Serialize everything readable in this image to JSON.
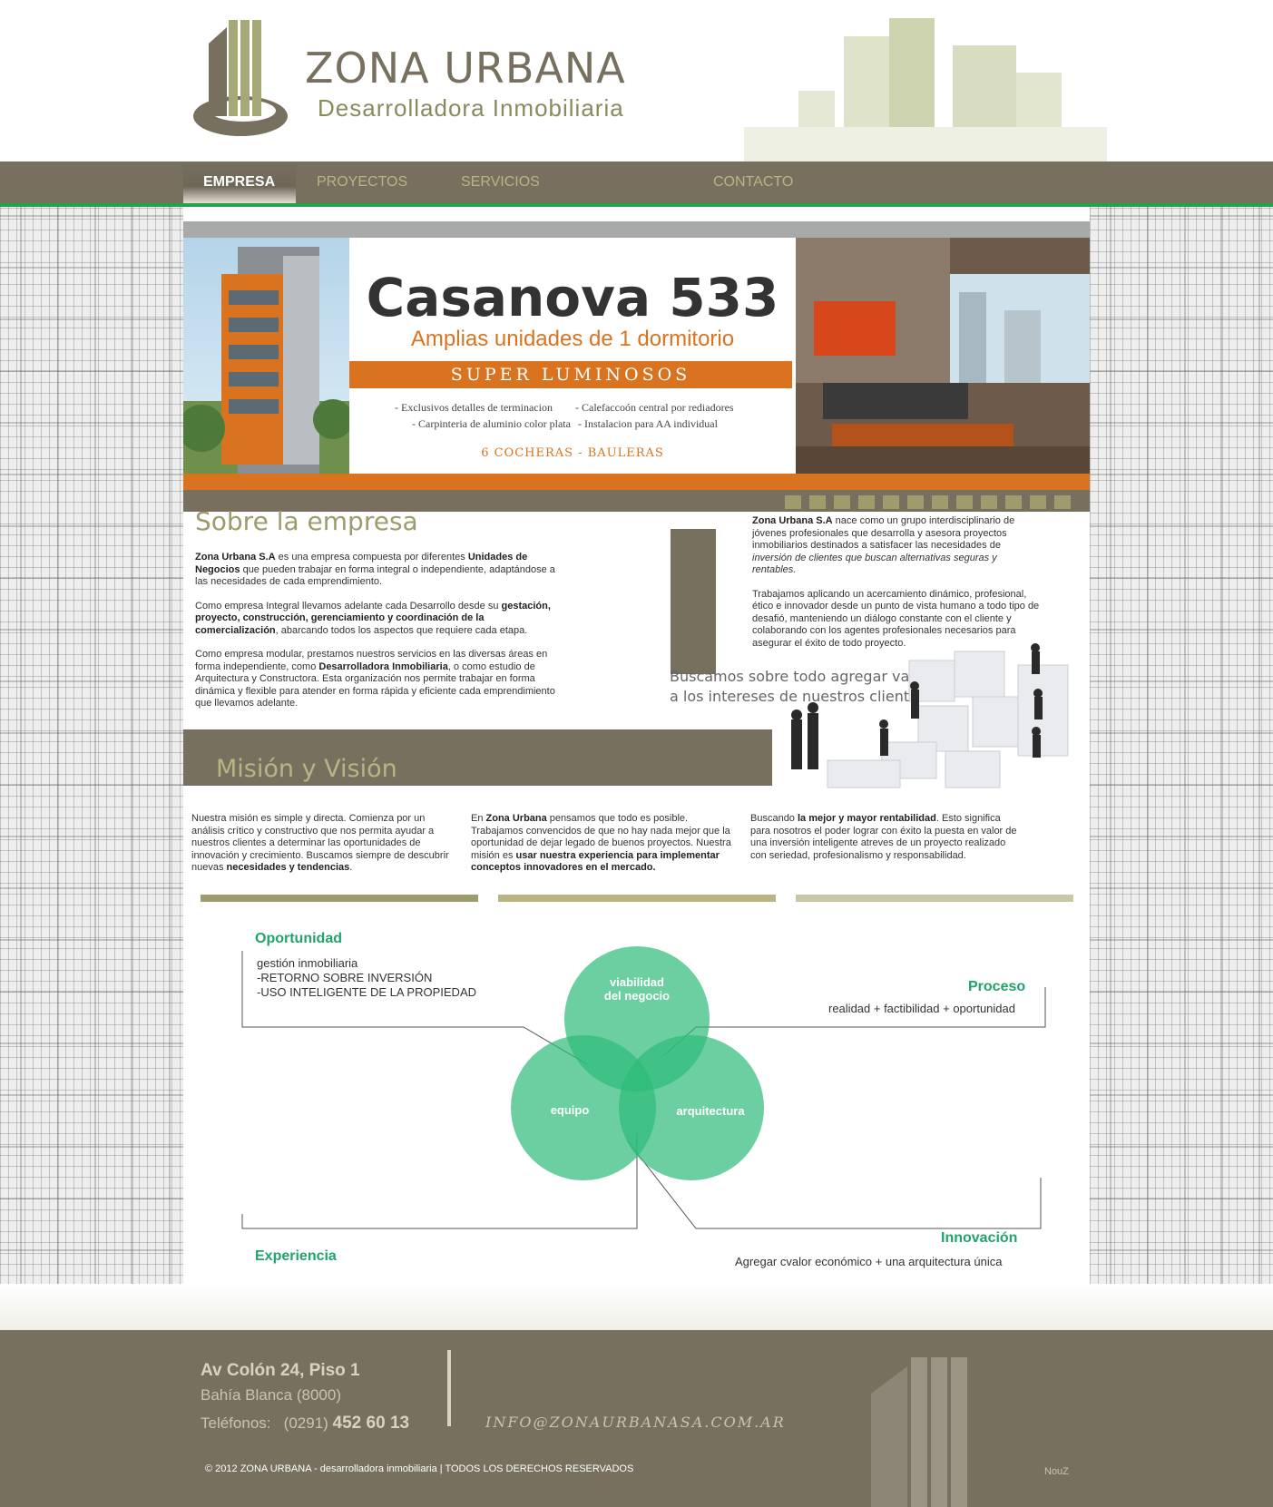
{
  "brand": {
    "name": "ZONA URBANA",
    "tagline": "Desarrolladora Inmobiliaria",
    "colors": {
      "primary": "#77705f",
      "olive": "#9e9c6c",
      "accent_green": "#23a34a",
      "orange": "#d9731f",
      "diagram_green": "#2ebb79"
    }
  },
  "nav": {
    "items": [
      {
        "label": "EMPRESA",
        "active": true
      },
      {
        "label": "PROYECTOS",
        "active": false
      },
      {
        "label": "SERVICIOS",
        "active": false
      },
      {
        "label": "CONTACTO",
        "active": false
      }
    ]
  },
  "banner": {
    "title": "Casanova 533",
    "subtitle": "Amplias unidades de 1 dormitorio",
    "strip": "SUPER LUMINOSOS",
    "features": [
      "- Exclusivos detalles de terminacion",
      "- Carpinteria de aluminio color plata",
      "- Calefaccoón central por rediadores",
      "- Instalacion para AA individual"
    ],
    "cocheras": "6 COCHERAS - BAULERAS",
    "slide_count": 12
  },
  "about": {
    "title": "Sobre la empresa",
    "slogan_line1": "Buscamos sobre todo agregar valor",
    "slogan_line2": "a los intereses de nuestros clientes."
  },
  "mision": {
    "title": "Misión y Visión"
  },
  "diagram": {
    "oportunidad": {
      "title": "Oportunidad",
      "line1": "gestión inmobiliaria",
      "line2": "-RETORNO SOBRE INVERSIÓN",
      "line3": "-USO INTELIGENTE DE LA PROPIEDAD"
    },
    "proceso": {
      "title": "Proceso",
      "text": "realidad + factibilidad + oportunidad"
    },
    "experiencia": {
      "title": "Experiencia"
    },
    "innovacion": {
      "title": "Innovación",
      "text": "Agregar cvalor económico + una arquitectura única"
    },
    "circles": {
      "top_line1": "viabilidad",
      "top_line2": "del negocio",
      "left": "equipo",
      "right": "arquitectura"
    }
  },
  "footer": {
    "address": "Av Colón 24, Piso 1",
    "city": "Bahía Blanca (8000)",
    "phone_label": "Teléfonos:",
    "phone_area": "(0291)",
    "phone_number": "452 60 13",
    "email": "INFO@ZONAURBANASA.COM.AR",
    "copyright": "© 2012 ZONA URBANA - desarrolladora inmobiliaria | TODOS LOS DERECHOS RESERVADOS",
    "credit": "NouZ"
  }
}
